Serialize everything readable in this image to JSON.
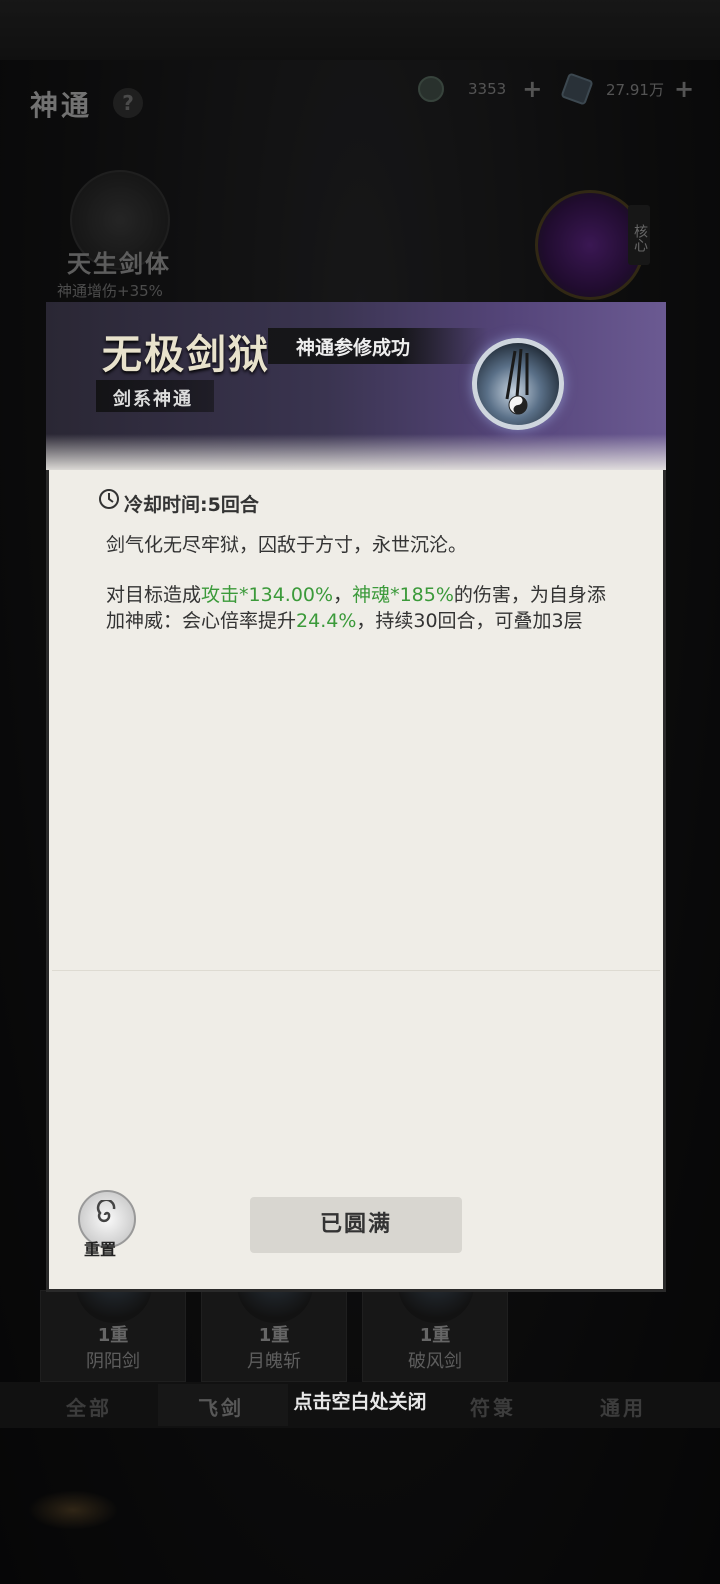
{
  "header": {
    "page_title": "神通",
    "help": "?",
    "currency_1": {
      "value": "3353",
      "plus": "+"
    },
    "currency_2": {
      "value": "27.91万",
      "plus": "+"
    }
  },
  "background": {
    "skill_name": "天生剑体",
    "skill_bonus": "神通增伤+35%",
    "core_tag": "核心",
    "cards": [
      {
        "level": "1重",
        "name": "阴阳剑"
      },
      {
        "level": "1重",
        "name": "月魄斩"
      },
      {
        "level": "1重",
        "name": "破风剑"
      }
    ],
    "tabs": [
      "全部",
      "飞剑",
      "符箓",
      "通用"
    ],
    "close_hint": "点击空白处关闭"
  },
  "modal": {
    "skill_name": "无极剑狱",
    "success_text": "神通参修成功",
    "type_label": "剑系神通",
    "cooldown": "冷却时间:5回合",
    "description": "剑气化无尽牢狱，囚敌于方寸，永世沉沦。",
    "effect": {
      "p1": "对目标造成",
      "g1": "攻击*134.00%",
      "p2": "，",
      "g2": "神魂*185%",
      "p3": "的伤害，为自身添加神威：会心倍率提升",
      "g3": "24.4%",
      "p4": "，持续30回合，可叠加3层"
    },
    "reset_label": "重置",
    "state_button": "已圆满"
  },
  "colors": {
    "highlight_green": "#3b9a3a",
    "header_purple": "#6b5a92",
    "panel_bg": "#efede7"
  }
}
